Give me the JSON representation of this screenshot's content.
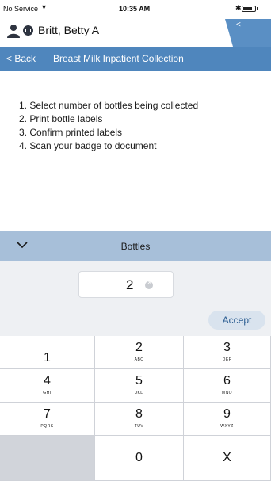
{
  "status_bar": {
    "carrier": "No Service",
    "wifi_icon": "wifi-icon",
    "time": "10:35 AM",
    "bluetooth_icon": "bluetooth-icon",
    "battery_icon": "battery-icon"
  },
  "patient": {
    "name": "Britt, Betty A",
    "tab_label": "<"
  },
  "nav": {
    "back_label": "< Back",
    "title": "Breast Milk Inpatient Collection"
  },
  "instructions": [
    "1. Select number of bottles being collected",
    "2. Print bottle labels",
    "3. Confirm printed labels",
    "4. Scan your badge to document"
  ],
  "bottles": {
    "header": "Bottles",
    "value": "2",
    "accept_label": "Accept"
  },
  "keypad": {
    "keys": [
      {
        "digit": "1",
        "letters": ""
      },
      {
        "digit": "2",
        "letters": "ABC"
      },
      {
        "digit": "3",
        "letters": "DEF"
      },
      {
        "digit": "4",
        "letters": "GHI"
      },
      {
        "digit": "5",
        "letters": "JKL"
      },
      {
        "digit": "6",
        "letters": "MNO"
      },
      {
        "digit": "7",
        "letters": "PQRS"
      },
      {
        "digit": "8",
        "letters": "TUV"
      },
      {
        "digit": "9",
        "letters": "WXYZ"
      },
      {
        "digit": "",
        "letters": ""
      },
      {
        "digit": "0",
        "letters": ""
      },
      {
        "digit": "X",
        "letters": ""
      }
    ]
  },
  "colors": {
    "nav_blue": "#4f86bd",
    "section_blue": "#a7bfd9",
    "accent": "#3a78c9"
  }
}
